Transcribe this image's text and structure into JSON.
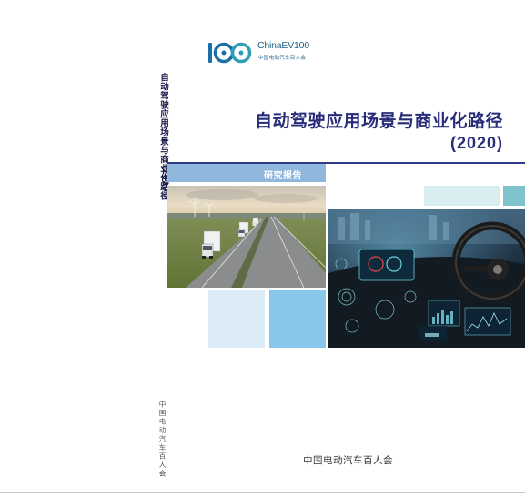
{
  "logo": {
    "mark_text": "100",
    "brand": "ChinaEV100",
    "subtitle": "中国电动汽车百人会",
    "colors": {
      "ring_blue": "#1b6fa8",
      "ring_teal": "#2a9fb5",
      "text": "#1b5f86"
    }
  },
  "spine": {
    "title": "自动驾驶应用场景与商业化路径",
    "year": "(2020)",
    "publisher": "中国电动汽车百人会"
  },
  "cover": {
    "title": "自动驾驶应用场景与商业化路径",
    "year": "(2020)",
    "label": "研究报告",
    "publisher": "中国电动汽车百人会"
  },
  "images": {
    "highway": "highway-trucks-photo",
    "cockpit": "car-cockpit-hud-photo"
  },
  "colors": {
    "title": "#262c7a",
    "rule": "#2f3a86",
    "label_bar": "#8fb7dc",
    "tile_light": "#dcecf6",
    "tile_blue": "#88c7ea",
    "tile_teal": "#7ec3cc"
  }
}
